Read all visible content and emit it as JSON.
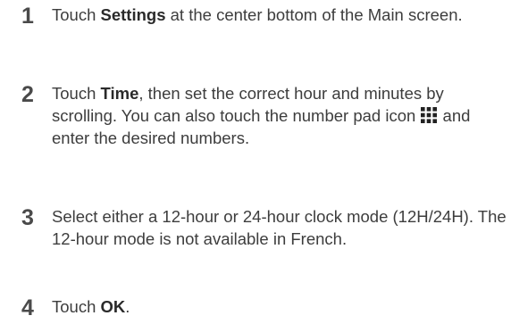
{
  "steps": [
    {
      "number": "1",
      "before": "Touch ",
      "bold": "Settings",
      "after": " at the center bottom of the Main screen."
    },
    {
      "number": "2",
      "before": "Touch ",
      "bold": "Time",
      "after": ", then set the correct hour and minutes by scrolling. You can also touch the number pad icon ",
      "icon": "number-pad-icon",
      "tail": " and enter the desired numbers."
    },
    {
      "number": "3",
      "text": "Select either a 12-hour or 24-hour clock mode (12H/24H). The 12-hour mode is not available in French."
    },
    {
      "number": "4",
      "before": "Touch ",
      "bold": "OK",
      "after": "."
    }
  ]
}
